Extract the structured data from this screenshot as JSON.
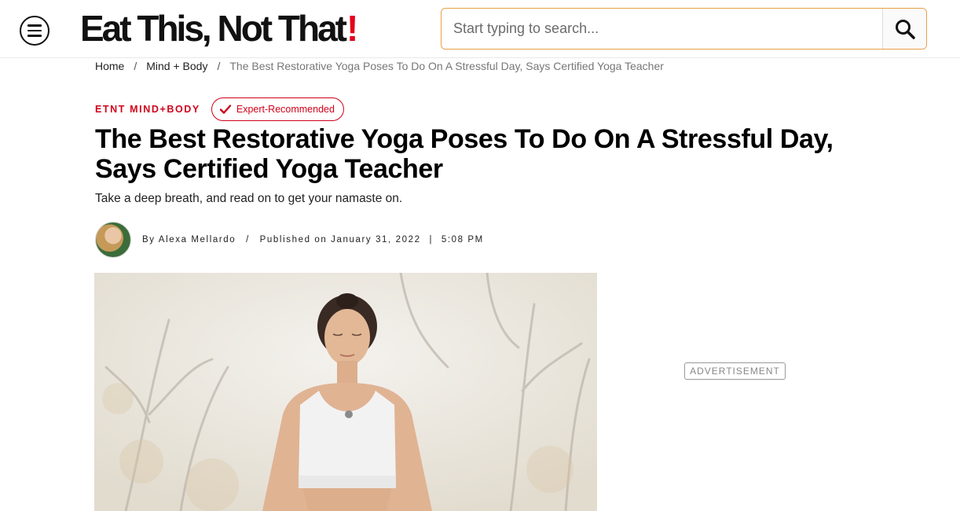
{
  "header": {
    "menu_icon": "hamburger-menu-icon",
    "logo_text": "Eat This, Not That",
    "logo_exclamation": "!",
    "search": {
      "placeholder": "Start typing to search...",
      "value": "",
      "icon": "search-icon"
    }
  },
  "breadcrumb": {
    "items": [
      "Home",
      "Mind + Body"
    ],
    "current": "The Best Restorative Yoga Poses To Do On A Stressful Day, Says Certified Yoga Teacher",
    "separator": "/"
  },
  "article": {
    "category": "ETNT MIND+BODY",
    "badge": {
      "label": "Expert-Recommended",
      "icon": "checkmark-icon"
    },
    "title": "The Best Restorative Yoga Poses To Do On A Stressful Day, Says Certified Yoga Teacher",
    "subtitle": "Take a deep breath, and read on to get your namaste on.",
    "byline": {
      "by": "By",
      "author": "Alexa Mellardo",
      "separator": "/",
      "published_label": "Published on",
      "date": "January 31, 2022",
      "pipe": "|",
      "time": "5:08 PM"
    }
  },
  "sidebar": {
    "ad_label": "ADVERTISEMENT"
  },
  "colors": {
    "accent_red": "#d0021b",
    "search_border": "#e8a04a",
    "logo_red": "#e5001c"
  }
}
